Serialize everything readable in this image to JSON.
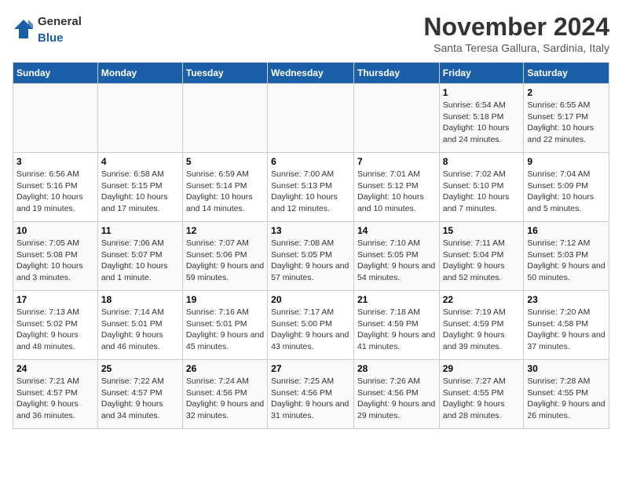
{
  "logo": {
    "general": "General",
    "blue": "Blue"
  },
  "header": {
    "month": "November 2024",
    "location": "Santa Teresa Gallura, Sardinia, Italy"
  },
  "weekdays": [
    "Sunday",
    "Monday",
    "Tuesday",
    "Wednesday",
    "Thursday",
    "Friday",
    "Saturday"
  ],
  "weeks": [
    [
      {
        "day": "",
        "info": ""
      },
      {
        "day": "",
        "info": ""
      },
      {
        "day": "",
        "info": ""
      },
      {
        "day": "",
        "info": ""
      },
      {
        "day": "",
        "info": ""
      },
      {
        "day": "1",
        "info": "Sunrise: 6:54 AM\nSunset: 5:18 PM\nDaylight: 10 hours and 24 minutes."
      },
      {
        "day": "2",
        "info": "Sunrise: 6:55 AM\nSunset: 5:17 PM\nDaylight: 10 hours and 22 minutes."
      }
    ],
    [
      {
        "day": "3",
        "info": "Sunrise: 6:56 AM\nSunset: 5:16 PM\nDaylight: 10 hours and 19 minutes."
      },
      {
        "day": "4",
        "info": "Sunrise: 6:58 AM\nSunset: 5:15 PM\nDaylight: 10 hours and 17 minutes."
      },
      {
        "day": "5",
        "info": "Sunrise: 6:59 AM\nSunset: 5:14 PM\nDaylight: 10 hours and 14 minutes."
      },
      {
        "day": "6",
        "info": "Sunrise: 7:00 AM\nSunset: 5:13 PM\nDaylight: 10 hours and 12 minutes."
      },
      {
        "day": "7",
        "info": "Sunrise: 7:01 AM\nSunset: 5:12 PM\nDaylight: 10 hours and 10 minutes."
      },
      {
        "day": "8",
        "info": "Sunrise: 7:02 AM\nSunset: 5:10 PM\nDaylight: 10 hours and 7 minutes."
      },
      {
        "day": "9",
        "info": "Sunrise: 7:04 AM\nSunset: 5:09 PM\nDaylight: 10 hours and 5 minutes."
      }
    ],
    [
      {
        "day": "10",
        "info": "Sunrise: 7:05 AM\nSunset: 5:08 PM\nDaylight: 10 hours and 3 minutes."
      },
      {
        "day": "11",
        "info": "Sunrise: 7:06 AM\nSunset: 5:07 PM\nDaylight: 10 hours and 1 minute."
      },
      {
        "day": "12",
        "info": "Sunrise: 7:07 AM\nSunset: 5:06 PM\nDaylight: 9 hours and 59 minutes."
      },
      {
        "day": "13",
        "info": "Sunrise: 7:08 AM\nSunset: 5:05 PM\nDaylight: 9 hours and 57 minutes."
      },
      {
        "day": "14",
        "info": "Sunrise: 7:10 AM\nSunset: 5:05 PM\nDaylight: 9 hours and 54 minutes."
      },
      {
        "day": "15",
        "info": "Sunrise: 7:11 AM\nSunset: 5:04 PM\nDaylight: 9 hours and 52 minutes."
      },
      {
        "day": "16",
        "info": "Sunrise: 7:12 AM\nSunset: 5:03 PM\nDaylight: 9 hours and 50 minutes."
      }
    ],
    [
      {
        "day": "17",
        "info": "Sunrise: 7:13 AM\nSunset: 5:02 PM\nDaylight: 9 hours and 48 minutes."
      },
      {
        "day": "18",
        "info": "Sunrise: 7:14 AM\nSunset: 5:01 PM\nDaylight: 9 hours and 46 minutes."
      },
      {
        "day": "19",
        "info": "Sunrise: 7:16 AM\nSunset: 5:01 PM\nDaylight: 9 hours and 45 minutes."
      },
      {
        "day": "20",
        "info": "Sunrise: 7:17 AM\nSunset: 5:00 PM\nDaylight: 9 hours and 43 minutes."
      },
      {
        "day": "21",
        "info": "Sunrise: 7:18 AM\nSunset: 4:59 PM\nDaylight: 9 hours and 41 minutes."
      },
      {
        "day": "22",
        "info": "Sunrise: 7:19 AM\nSunset: 4:59 PM\nDaylight: 9 hours and 39 minutes."
      },
      {
        "day": "23",
        "info": "Sunrise: 7:20 AM\nSunset: 4:58 PM\nDaylight: 9 hours and 37 minutes."
      }
    ],
    [
      {
        "day": "24",
        "info": "Sunrise: 7:21 AM\nSunset: 4:57 PM\nDaylight: 9 hours and 36 minutes."
      },
      {
        "day": "25",
        "info": "Sunrise: 7:22 AM\nSunset: 4:57 PM\nDaylight: 9 hours and 34 minutes."
      },
      {
        "day": "26",
        "info": "Sunrise: 7:24 AM\nSunset: 4:56 PM\nDaylight: 9 hours and 32 minutes."
      },
      {
        "day": "27",
        "info": "Sunrise: 7:25 AM\nSunset: 4:56 PM\nDaylight: 9 hours and 31 minutes."
      },
      {
        "day": "28",
        "info": "Sunrise: 7:26 AM\nSunset: 4:56 PM\nDaylight: 9 hours and 29 minutes."
      },
      {
        "day": "29",
        "info": "Sunrise: 7:27 AM\nSunset: 4:55 PM\nDaylight: 9 hours and 28 minutes."
      },
      {
        "day": "30",
        "info": "Sunrise: 7:28 AM\nSunset: 4:55 PM\nDaylight: 9 hours and 26 minutes."
      }
    ]
  ]
}
